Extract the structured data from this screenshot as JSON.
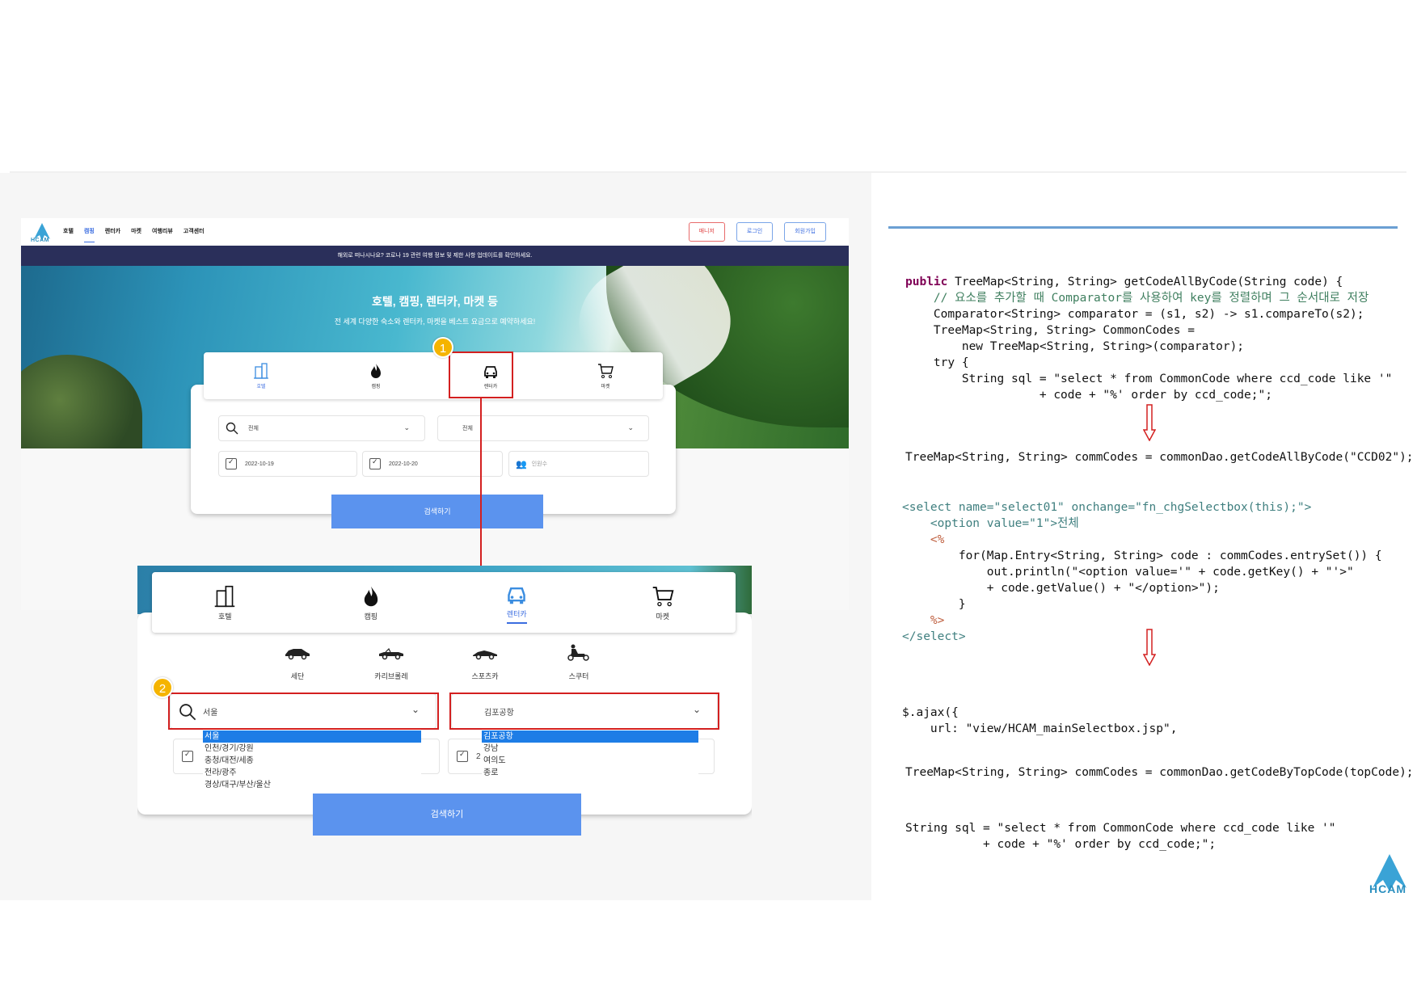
{
  "site": {
    "logo_text": "HCAM",
    "nav": [
      "호텔",
      "캠핑",
      "렌터카",
      "마켓",
      "여행리뷰",
      "고객센터"
    ],
    "nav_buttons": [
      "매니저",
      "로그인",
      "회원가입"
    ],
    "notice": "해외로 떠나시나요? 코로나 19 관련 여행 정보 및 제한 사항 업데이트를 확인하세요.",
    "hero_title": "호텔, 캠핑, 렌터카, 마켓 등",
    "hero_sub": "전 세계 다양한 숙소와 렌터카, 마켓을 베스트 요금으로 예약하세요!",
    "tabs": [
      "호텔",
      "캠핑",
      "렌터카",
      "마켓"
    ],
    "field_region": "전체",
    "field_area": "전체",
    "date_in": "2022-10-19",
    "date_out": "2022-10-20",
    "guests_placeholder": "인원수",
    "search_button": "검색하기"
  },
  "badges": [
    "1",
    "2"
  ],
  "zoom": {
    "tabs": [
      "호텔",
      "캠핑",
      "렌터카",
      "마켓"
    ],
    "car_types": [
      "세단",
      "카리브롤레",
      "스포츠카",
      "스쿠터"
    ],
    "region_value": "서울",
    "area_value": "김포공항",
    "region_options": [
      "서울",
      "인천/경기/강원",
      "충청/대전/세종",
      "전라/광주",
      "경상/대구/부산/울산"
    ],
    "area_options": [
      "김포공항",
      "강남",
      "여의도",
      "종로"
    ],
    "date_partial": "2",
    "search_button": "검색하기"
  },
  "code": {
    "block1": [
      "public TreeMap<String, String> getCodeAllByCode(String code) {",
      "    // 요소를 추가할 때 Comparator를 사용하여 key를 정렬하며 그 순서대로 저장",
      "    Comparator<String> comparator = (s1, s2) -> s1.compareTo(s2);",
      "    TreeMap<String, String> CommonCodes =",
      "        new TreeMap<String, String>(comparator);",
      "    try {",
      "        String sql = \"select * from CommonCode where ccd_code like '\"",
      "                   + code + \"%' order by ccd_code;\";"
    ],
    "line2": "TreeMap<String, String> commCodes = commonDao.getCodeAllByCode(\"CCD02\");",
    "block3": [
      "<select name=\"select01\" onchange=\"fn_chgSelectbox(this);\">",
      "    <option value=\"1\">전체",
      "    <%",
      "        for(Map.Entry<String, String> code : commCodes.entrySet()) {",
      "            out.println(\"<option value='\" + code.getKey() + \"'>\"",
      "            + code.getValue() + \"</option>\");",
      "        }",
      "    %>",
      "</select>"
    ],
    "block4": [
      "$.ajax({",
      "    url: \"view/HCAM_mainSelectbox.jsp\","
    ],
    "line5": "TreeMap<String, String> commCodes = commonDao.getCodeByTopCode(topCode);",
    "block6": [
      "String sql = \"select * from CommonCode where ccd_code like '\"",
      "           + code + \"%' order by ccd_code;\";"
    ],
    "footer_logo": "HCAM"
  },
  "colors": {
    "accent": "#3b6de0",
    "highlight_red": "#d32020",
    "badge": "#f5b400",
    "button": "#5b93ee"
  }
}
